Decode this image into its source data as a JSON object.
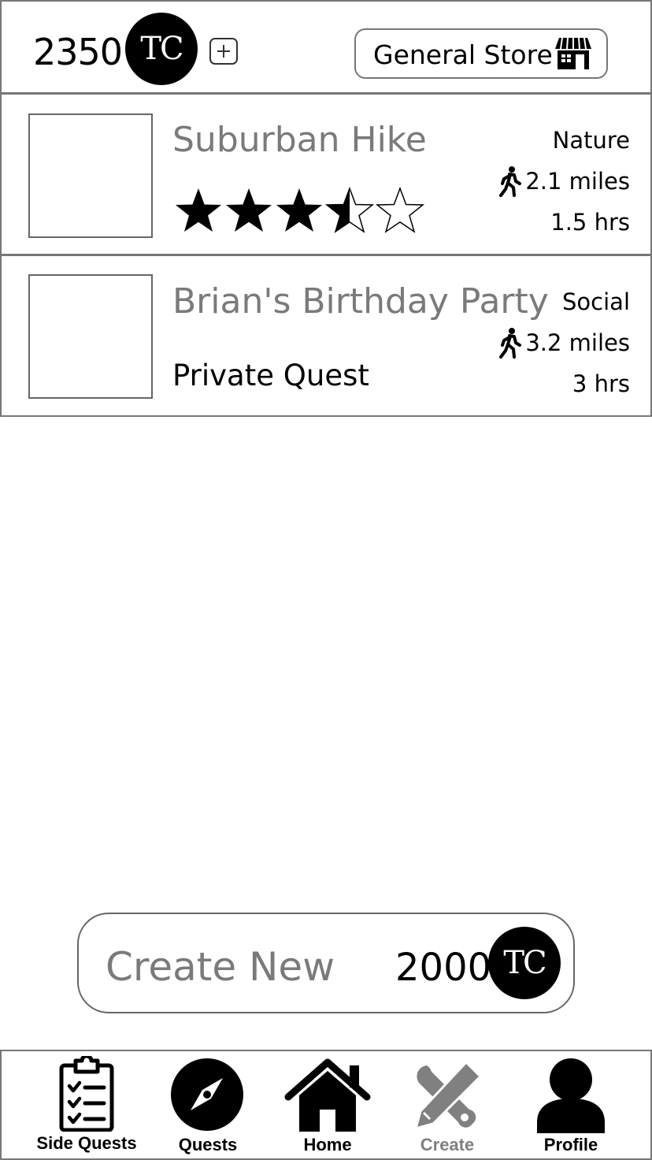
{
  "header": {
    "coin_balance": "2350",
    "coin_symbol": "TC",
    "store_label": "General Store"
  },
  "quests": [
    {
      "title": "Suburban Hike",
      "rating": 3.5,
      "rating_max": 5,
      "category": "Nature",
      "distance": "2.1 miles",
      "duration": "1.5 hrs"
    },
    {
      "title": "Brian's Birthday Party",
      "subtitle": "Private Quest",
      "category": "Social",
      "distance": "3.2 miles",
      "duration": "3 hrs"
    }
  ],
  "create": {
    "label": "Create New",
    "cost": "2000",
    "coin_symbol": "TC"
  },
  "nav": {
    "items": [
      {
        "label": "Side Quests",
        "icon": "clipboard-checklist-icon",
        "active": false
      },
      {
        "label": "Quests",
        "icon": "compass-icon",
        "active": false
      },
      {
        "label": "Home",
        "icon": "home-icon",
        "active": false
      },
      {
        "label": "Create",
        "icon": "tools-icon",
        "active": true
      },
      {
        "label": "Profile",
        "icon": "user-icon",
        "active": false
      }
    ]
  },
  "colors": {
    "border": "#777777",
    "muted_text": "#7a7a7a",
    "active_nav": "#808080"
  }
}
